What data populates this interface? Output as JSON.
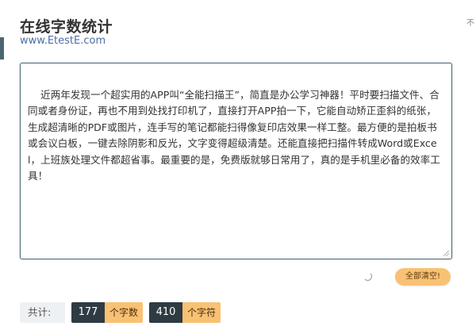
{
  "header": {
    "title": "在线字数统计",
    "subtitle": "www.EtestE.com",
    "corner_text": "不"
  },
  "editor": {
    "content": "近两年发现一个超实用的APP叫“全能扫描王”，简直是办公学习神器！平时要扫描文件、合同或者身份证，再也不用到处找打印机了，直接打开APP拍一下，它能自动矫正歪斜的纸张，生成超清晰的PDF或图片，连手写的笔记都能扫得像复印店效果一样工整。最方便的是拍板书或会议白板，一键去除阴影和反光，文字变得超级清楚。还能直接把扫描件转成Word或Excel，上班族处理文件都超省事。最重要的是，免费版就够日常用了，真的是手机里必备的效率工具！"
  },
  "actions": {
    "clear_label": "全部清空!"
  },
  "stats": {
    "label": "共计:",
    "char_count": "177",
    "char_unit": "个字数",
    "symbol_count": "410",
    "symbol_unit": "个字符"
  },
  "colors": {
    "accent": "#4a6670",
    "button": "#f9c173",
    "stat_dark": "#2f3b43",
    "link": "#4a6fa5"
  }
}
